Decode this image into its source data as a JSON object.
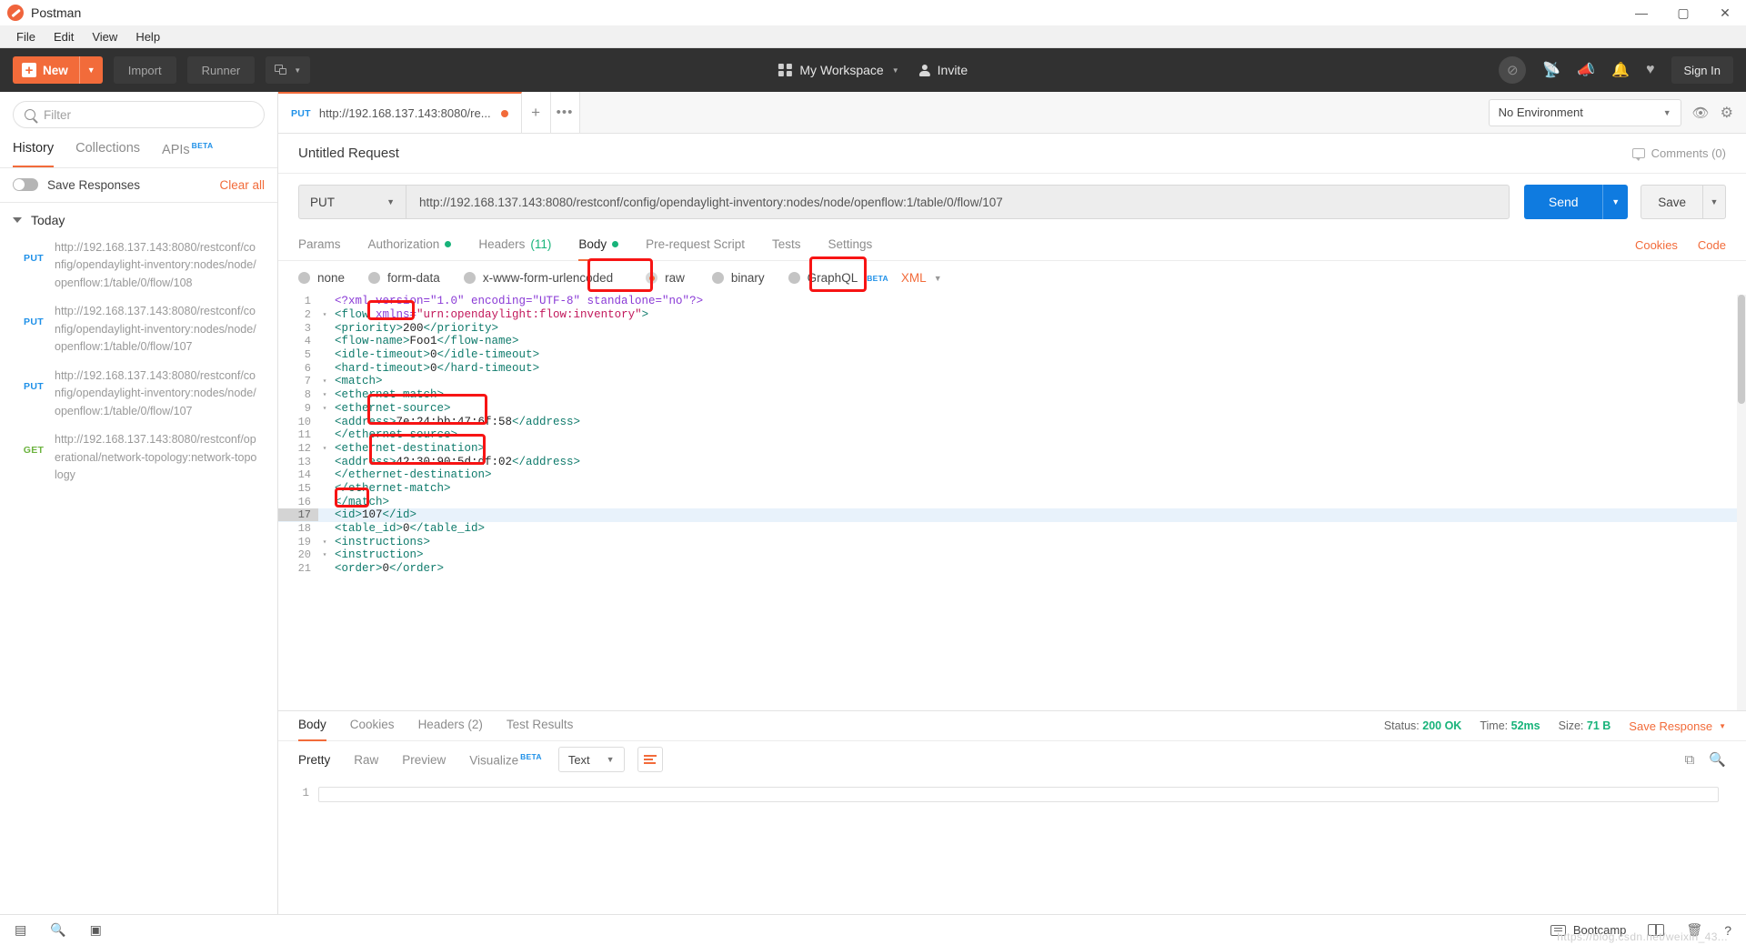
{
  "window": {
    "app_title": "Postman",
    "minimize": "—",
    "maximize": "▢",
    "close": "✕"
  },
  "menubar": {
    "items": [
      "File",
      "Edit",
      "View",
      "Help"
    ]
  },
  "toolbar": {
    "new_label": "New",
    "new_caret": "▼",
    "import_label": "Import",
    "runner_label": "Runner",
    "workspace_label": "My Workspace",
    "workspace_caret": "▼",
    "invite_label": "Invite",
    "sign_in_label": "Sign In"
  },
  "sidebar": {
    "filter_placeholder": "Filter",
    "tabs": [
      {
        "label": "History",
        "active": true,
        "beta": ""
      },
      {
        "label": "Collections",
        "active": false,
        "beta": ""
      },
      {
        "label": "APIs",
        "active": false,
        "beta": "BETA"
      }
    ],
    "save_responses_label": "Save Responses",
    "clear_all_label": "Clear all",
    "group_label": "Today",
    "history": [
      {
        "method": "PUT",
        "url": "http://192.168.137.143:8080/restconf/config/opendaylight-inventory:nodes/node/openflow:1/table/0/flow/108"
      },
      {
        "method": "PUT",
        "url": "http://192.168.137.143:8080/restconf/config/opendaylight-inventory:nodes/node/openflow:1/table/0/flow/107"
      },
      {
        "method": "PUT",
        "url": "http://192.168.137.143:8080/restconf/config/opendaylight-inventory:nodes/node/openflow:1/table/0/flow/107"
      },
      {
        "method": "GET",
        "url": "http://192.168.137.143:8080/restconf/operational/network-topology:network-topology"
      }
    ]
  },
  "tabstrip": {
    "request_tab": {
      "method": "PUT",
      "url": "http://192.168.137.143:8080/re...",
      "unsaved": true
    },
    "new_tab": "+",
    "more": "•••",
    "environment": "No Environment",
    "environment_caret": "▼",
    "eye_icon": "👁",
    "gear_icon": "⚙"
  },
  "request": {
    "title": "Untitled Request",
    "comments_label": "Comments (0)",
    "method": "PUT",
    "method_caret": "▼",
    "url": "http://192.168.137.143:8080/restconf/config/opendaylight-inventory:nodes/node/openflow:1/table/0/flow/107",
    "url_highlight": "/107",
    "send_label": "Send",
    "send_caret": "▼",
    "save_label": "Save",
    "save_caret": "▼",
    "tabs": [
      {
        "label": "Params",
        "active": false,
        "dot": false,
        "count": ""
      },
      {
        "label": "Authorization",
        "active": false,
        "dot": true,
        "count": ""
      },
      {
        "label": "Headers",
        "active": false,
        "dot": false,
        "count": "(11)"
      },
      {
        "label": "Body",
        "active": true,
        "dot": true,
        "count": ""
      },
      {
        "label": "Pre-request Script",
        "active": false,
        "dot": false,
        "count": ""
      },
      {
        "label": "Tests",
        "active": false,
        "dot": false,
        "count": ""
      },
      {
        "label": "Settings",
        "active": false,
        "dot": false,
        "count": ""
      }
    ],
    "cookies_link": "Cookies",
    "code_link": "Code",
    "body_options": [
      {
        "label": "none",
        "selected": false,
        "beta": ""
      },
      {
        "label": "form-data",
        "selected": false,
        "beta": ""
      },
      {
        "label": "x-www-form-urlencoded",
        "selected": false,
        "beta": ""
      },
      {
        "label": "raw",
        "selected": true,
        "beta": ""
      },
      {
        "label": "binary",
        "selected": false,
        "beta": ""
      },
      {
        "label": "GraphQL",
        "selected": false,
        "beta": "BETA"
      }
    ],
    "format": "XML",
    "format_caret": "▼"
  },
  "editor": {
    "highlighted_line": 17,
    "lines": [
      {
        "n": 1,
        "fold": "",
        "segs": [
          {
            "t": "pi",
            "v": "<?xml version=\"1.0\" encoding=\"UTF-8\" standalone=\"no\"?>"
          }
        ]
      },
      {
        "n": 2,
        "fold": "▾",
        "segs": [
          {
            "t": "tg",
            "v": "<flow "
          },
          {
            "t": "at",
            "v": "xmlns="
          },
          {
            "t": "av",
            "v": "\"urn:opendaylight:flow:inventory\""
          },
          {
            "t": "tg",
            "v": ">"
          }
        ]
      },
      {
        "n": 3,
        "fold": "",
        "segs": [
          {
            "t": "tg",
            "v": "<priority>"
          },
          {
            "t": "tx",
            "v": "200"
          },
          {
            "t": "tg",
            "v": "</priority>"
          }
        ]
      },
      {
        "n": 4,
        "fold": "",
        "segs": [
          {
            "t": "tg",
            "v": "<flow-name>"
          },
          {
            "t": "tx",
            "v": "Foo1"
          },
          {
            "t": "tg",
            "v": "</flow-name>"
          }
        ]
      },
      {
        "n": 5,
        "fold": "",
        "segs": [
          {
            "t": "tg",
            "v": "<idle-timeout>"
          },
          {
            "t": "tx",
            "v": "0"
          },
          {
            "t": "tg",
            "v": "</idle-timeout>"
          }
        ]
      },
      {
        "n": 6,
        "fold": "",
        "segs": [
          {
            "t": "tg",
            "v": "<hard-timeout>"
          },
          {
            "t": "tx",
            "v": "0"
          },
          {
            "t": "tg",
            "v": "</hard-timeout>"
          }
        ]
      },
      {
        "n": 7,
        "fold": "▾",
        "segs": [
          {
            "t": "tg",
            "v": "<match>"
          }
        ]
      },
      {
        "n": 8,
        "fold": "▾",
        "segs": [
          {
            "t": "tg",
            "v": "<ethernet-match>"
          }
        ]
      },
      {
        "n": 9,
        "fold": "▾",
        "segs": [
          {
            "t": "tg",
            "v": "<ethernet-source>"
          }
        ]
      },
      {
        "n": 10,
        "fold": "",
        "segs": [
          {
            "t": "tg",
            "v": "<address>"
          },
          {
            "t": "tx",
            "v": "7e:24:bb:47:6f:58"
          },
          {
            "t": "tg",
            "v": "</address>"
          }
        ]
      },
      {
        "n": 11,
        "fold": "",
        "segs": [
          {
            "t": "tg",
            "v": "</ethernet-source>"
          }
        ]
      },
      {
        "n": 12,
        "fold": "▾",
        "segs": [
          {
            "t": "tg",
            "v": "<ethernet-destination>"
          }
        ]
      },
      {
        "n": 13,
        "fold": "",
        "segs": [
          {
            "t": "tg",
            "v": "<address>"
          },
          {
            "t": "tx",
            "v": "42:30:90:5d:df:02"
          },
          {
            "t": "tg",
            "v": "</address>"
          }
        ]
      },
      {
        "n": 14,
        "fold": "",
        "segs": [
          {
            "t": "tg",
            "v": "</ethernet-destination>"
          }
        ]
      },
      {
        "n": 15,
        "fold": "",
        "segs": [
          {
            "t": "tg",
            "v": "</ethernet-match>"
          }
        ]
      },
      {
        "n": 16,
        "fold": "",
        "segs": [
          {
            "t": "tg",
            "v": "</match>"
          }
        ]
      },
      {
        "n": 17,
        "fold": "",
        "segs": [
          {
            "t": "tg",
            "v": "<id>"
          },
          {
            "t": "tx",
            "v": "107"
          },
          {
            "t": "tg",
            "v": "</id>"
          }
        ]
      },
      {
        "n": 18,
        "fold": "",
        "segs": [
          {
            "t": "tg",
            "v": "<table_id>"
          },
          {
            "t": "tx",
            "v": "0"
          },
          {
            "t": "tg",
            "v": "</table_id>"
          }
        ]
      },
      {
        "n": 19,
        "fold": "▾",
        "segs": [
          {
            "t": "tg",
            "v": "<instructions>"
          }
        ]
      },
      {
        "n": 20,
        "fold": "▾",
        "segs": [
          {
            "t": "tg",
            "v": "<instruction>"
          }
        ]
      },
      {
        "n": 21,
        "fold": "",
        "segs": [
          {
            "t": "tg",
            "v": "<order>"
          },
          {
            "t": "tx",
            "v": "0"
          },
          {
            "t": "tg",
            "v": "</order>"
          }
        ]
      }
    ]
  },
  "response": {
    "tabs": [
      {
        "label": "Body",
        "active": true
      },
      {
        "label": "Cookies",
        "active": false
      },
      {
        "label": "Headers (2)",
        "active": false
      },
      {
        "label": "Test Results",
        "active": false
      }
    ],
    "status_label": "Status:",
    "status_value": "200 OK",
    "time_label": "Time:",
    "time_value": "52ms",
    "size_label": "Size:",
    "size_value": "71 B",
    "save_response_label": "Save Response",
    "save_response_caret": "▼",
    "view_modes": [
      {
        "label": "Pretty",
        "active": true
      },
      {
        "label": "Raw",
        "active": false
      },
      {
        "label": "Preview",
        "active": false
      },
      {
        "label": "Visualize",
        "active": false,
        "beta": "BETA"
      }
    ],
    "format": "Text",
    "format_caret": "▼",
    "line_number": "1"
  },
  "statusbar": {
    "bootcamp_label": "Bootcamp",
    "watermark": "https://blog.csdn.net/weixin_43...",
    "sidebar_toggle_icon": "sidebar-toggle-icon",
    "find_icon": "search-icon",
    "console_icon": "console-icon"
  }
}
